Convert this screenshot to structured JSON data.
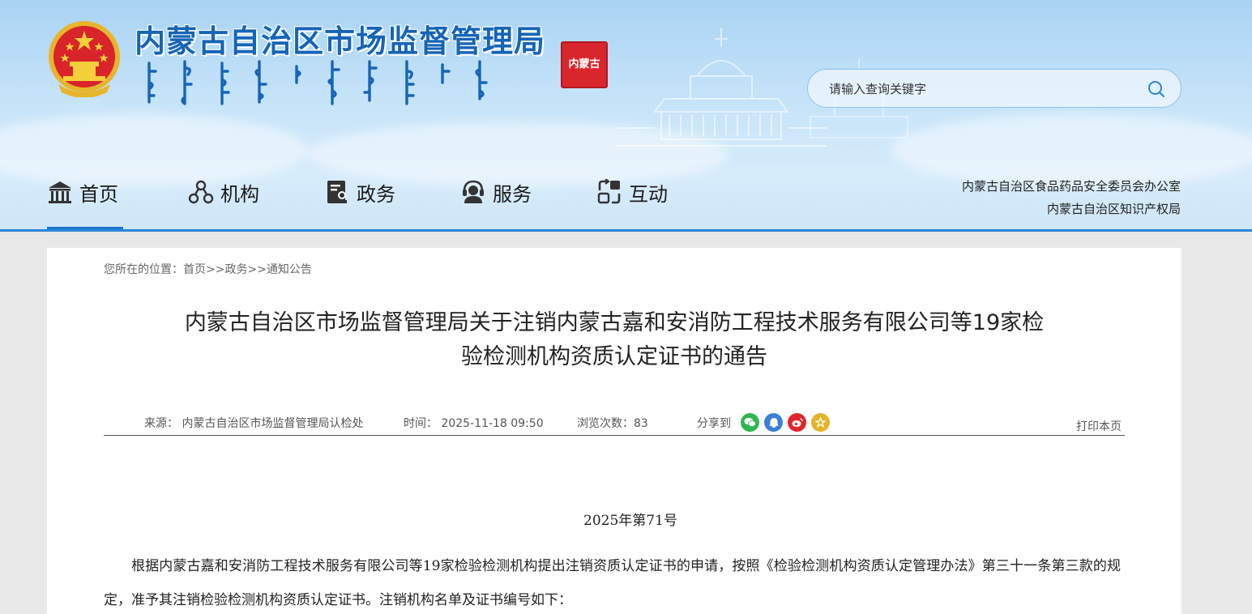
{
  "header": {
    "site_title": "内蒙古自治区市场监督管理局",
    "seal_text": "内蒙古",
    "search": {
      "placeholder": "请输入查询关键字"
    },
    "nav": [
      {
        "label": "首页",
        "icon": "home-icon"
      },
      {
        "label": "机构",
        "icon": "org-icon"
      },
      {
        "label": "政务",
        "icon": "document-icon"
      },
      {
        "label": "服务",
        "icon": "service-icon"
      },
      {
        "label": "互动",
        "icon": "interact-icon"
      }
    ],
    "related_links": [
      "内蒙古自治区食品药品安全委员会办公室",
      "内蒙古自治区知识产权局"
    ]
  },
  "breadcrumb": {
    "prefix": "您所在的位置：",
    "items": [
      "首页",
      "政务",
      "通知公告"
    ],
    "separator": ">>"
  },
  "article": {
    "title_line1": "内蒙古自治区市场监督管理局关于注销内蒙古嘉和安消防工程技术服务有限公司等19家检",
    "title_line2": "验检测机构资质认定证书的通告",
    "source": "来源： 内蒙古自治区市场监督管理局认检处",
    "time": "时间： 2025-11-18 09:50",
    "views": "浏览次数：83",
    "share_label": "分享到",
    "share_targets": [
      "wechat-icon",
      "qq-icon",
      "weibo-icon",
      "favorite-icon"
    ],
    "print_label": "打印本页",
    "doc_number": "2025年第71号",
    "body": "根据内蒙古嘉和安消防工程技术服务有限公司等19家检验检测机构提出注销资质认定证书的申请，按照《检验检测机构资质认定管理办法》第三十一条第三款的规定，准予其注销检验检测机构资质认定证书。注销机构名单及证书编号如下："
  },
  "colors": {
    "brand_blue": "#1565b8",
    "nav_active": "#1b77d2",
    "seal_red": "#d9262c"
  }
}
